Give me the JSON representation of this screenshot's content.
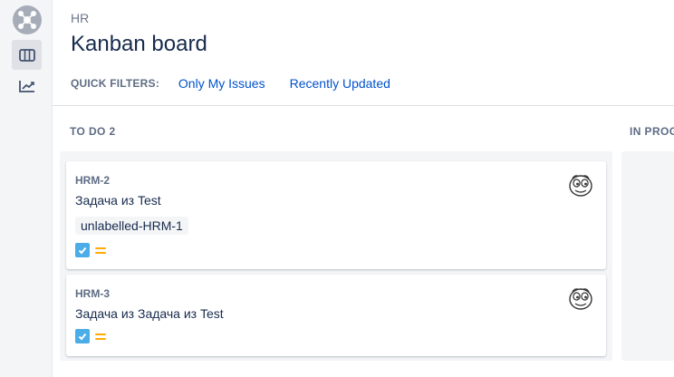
{
  "colors": {
    "accent": "#0052cc",
    "task": "#4bade8",
    "priority_medium": "#ffab00",
    "column_bg": "#f4f5f7"
  },
  "sidebar": {
    "icons": [
      "project-avatar-icon",
      "board-icon",
      "reports-icon"
    ]
  },
  "header": {
    "breadcrumb": "HR",
    "title": "Kanban board"
  },
  "quick_filters": {
    "label": "QUICK FILTERS:",
    "items": [
      {
        "label": "Only My Issues"
      },
      {
        "label": "Recently Updated"
      }
    ]
  },
  "columns": [
    {
      "title": "TO DO",
      "count": "2",
      "cards": [
        {
          "key": "HRM-2",
          "summary": "Задача из Test",
          "label": "unlabelled-HRM-1",
          "type_icon": "task-icon",
          "priority_icon": "medium-priority-icon",
          "assignee_icon": "cartoon-face-avatar-icon"
        },
        {
          "key": "HRM-3",
          "summary": "Задача из Задача из Test",
          "type_icon": "task-icon",
          "priority_icon": "medium-priority-icon",
          "assignee_icon": "cartoon-face-avatar-icon"
        }
      ]
    },
    {
      "title": "IN PROG",
      "count": "",
      "cards": []
    }
  ]
}
